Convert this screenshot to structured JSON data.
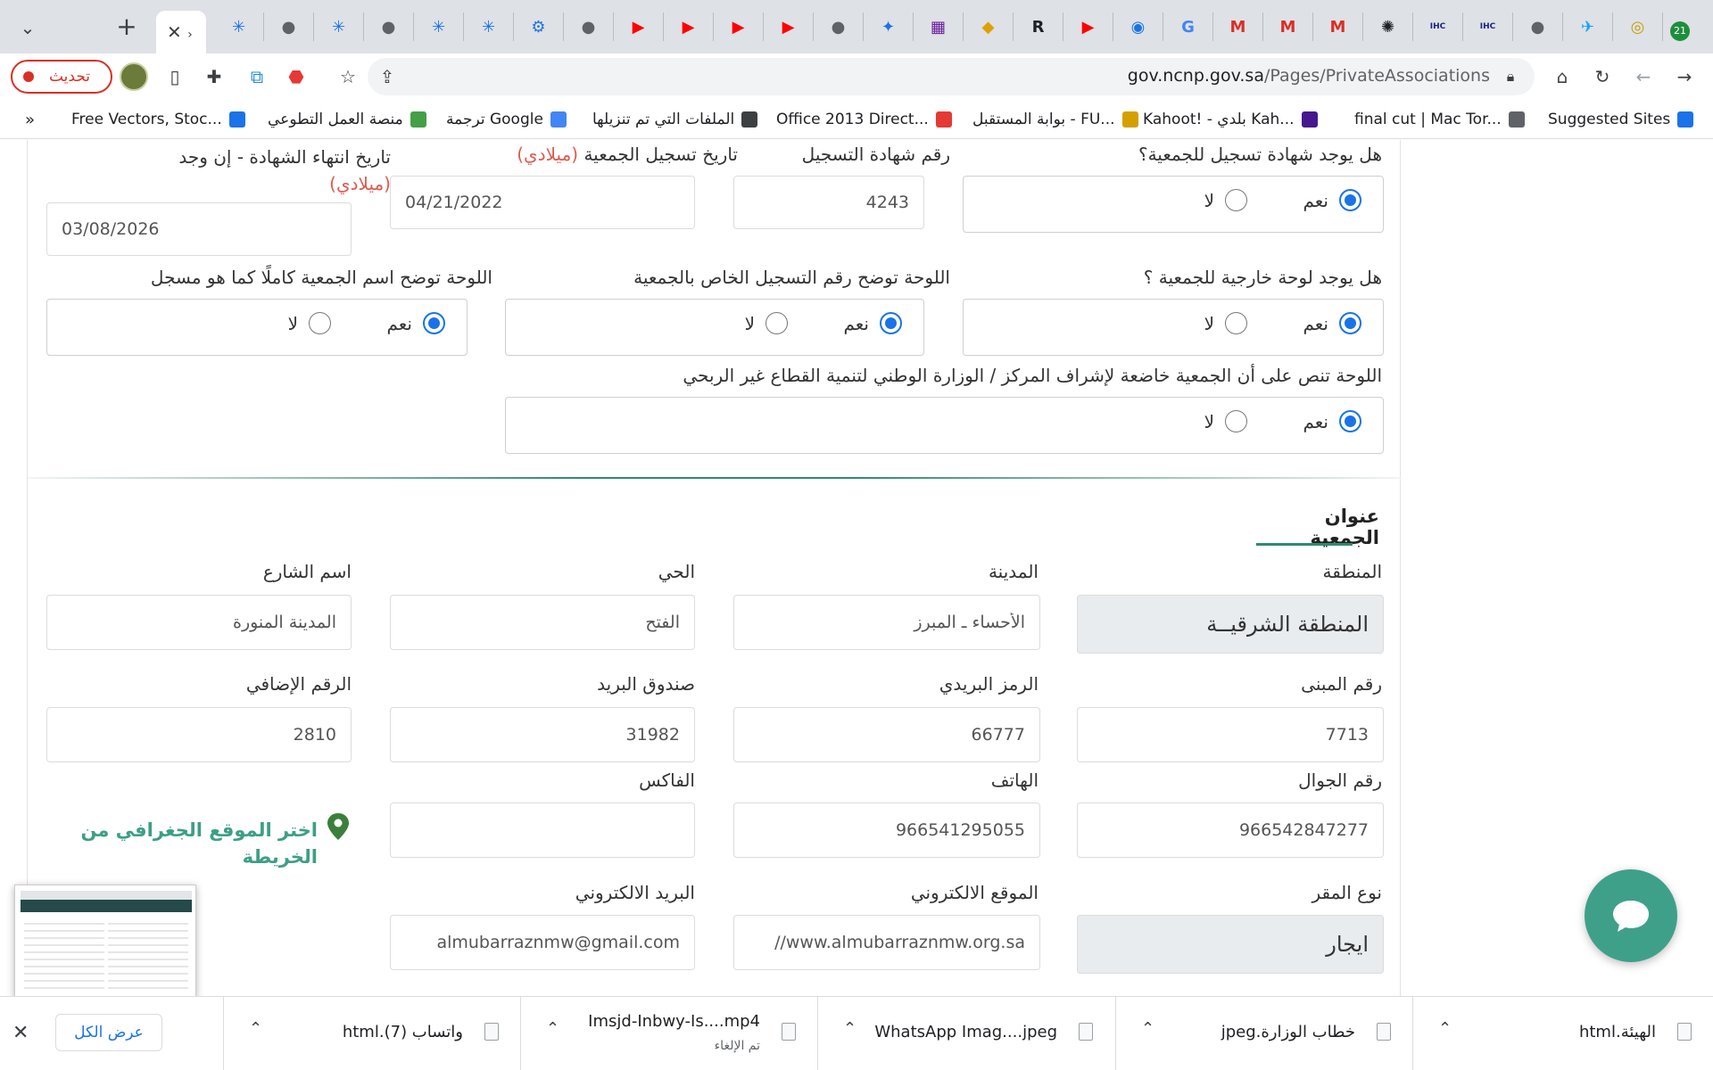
{
  "browser": {
    "url_host": "gov.ncnp.gov.sa",
    "url_path": "/Pages/PrivateAssociations",
    "reload_label": "تحديث",
    "tab_count_badge": "21",
    "tab_icons": [
      {
        "name": "asterisk-icon",
        "color": "#1a73e8",
        "glyph": "✳"
      },
      {
        "name": "globe-icon",
        "color": "#5f6368",
        "glyph": "●"
      },
      {
        "name": "asterisk-icon",
        "color": "#1a73e8",
        "glyph": "✳"
      },
      {
        "name": "globe-icon",
        "color": "#5f6368",
        "glyph": "●"
      },
      {
        "name": "asterisk-icon",
        "color": "#1a73e8",
        "glyph": "✳"
      },
      {
        "name": "asterisk-icon",
        "color": "#1a73e8",
        "glyph": "✳"
      },
      {
        "name": "gear-icon",
        "color": "#1a73e8",
        "glyph": "⚙"
      },
      {
        "name": "globe-icon",
        "color": "#5f6368",
        "glyph": "●"
      },
      {
        "name": "youtube-icon",
        "color": "#ff0000",
        "glyph": "▶"
      },
      {
        "name": "youtube-icon",
        "color": "#ff0000",
        "glyph": "▶"
      },
      {
        "name": "youtube-icon",
        "color": "#ff0000",
        "glyph": "▶"
      },
      {
        "name": "youtube-icon",
        "color": "#ff0000",
        "glyph": "▶"
      },
      {
        "name": "globe-icon",
        "color": "#5f6368",
        "glyph": "●"
      },
      {
        "name": "star-icon",
        "color": "#1a73e8",
        "glyph": "✦"
      },
      {
        "name": "grid-icon",
        "color": "#6a1b9a",
        "glyph": "▦"
      },
      {
        "name": "leaf-icon",
        "color": "#e0a000",
        "glyph": "◆"
      },
      {
        "name": "r-icon",
        "color": "#202124",
        "glyph": "R"
      },
      {
        "name": "youtube-icon",
        "color": "#ff0000",
        "glyph": "▶"
      },
      {
        "name": "robot-icon",
        "color": "#1a73e8",
        "glyph": "◉"
      },
      {
        "name": "translate-icon",
        "color": "#4285f4",
        "glyph": "G"
      },
      {
        "name": "gmail-icon",
        "color": "#d93025",
        "glyph": "M"
      },
      {
        "name": "gmail-icon",
        "color": "#d93025",
        "glyph": "M"
      },
      {
        "name": "gmail-icon",
        "color": "#d93025",
        "glyph": "M"
      },
      {
        "name": "chatgpt-icon",
        "color": "#202124",
        "glyph": "✺"
      },
      {
        "name": "ihc-icon",
        "color": "#1a237e",
        "glyph": "IHC"
      },
      {
        "name": "ihc-icon",
        "color": "#1a237e",
        "glyph": "IHC"
      },
      {
        "name": "globe-icon",
        "color": "#5f6368",
        "glyph": "●"
      },
      {
        "name": "twitter-icon",
        "color": "#1da1f2",
        "glyph": "✈"
      },
      {
        "name": "logo-icon",
        "color": "#c5a000",
        "glyph": "◎"
      }
    ],
    "bookmarks": [
      {
        "label": "Suggested Sites",
        "color": "#1a73e8"
      },
      {
        "label": "final cut | Mac Tor...",
        "color": "#5f6368"
      },
      {
        "label": "Kahoot! - بلدي Kah...",
        "color": "#46178f"
      },
      {
        "label": "بوابة المستقبل - FU...",
        "color": "#d4a000"
      },
      {
        "label": "Office 2013 Direct...",
        "color": "#e53935"
      },
      {
        "label": "الملفات التي تم تنزيلها",
        "color": "#3c4043"
      },
      {
        "label": "ترجمة Google",
        "color": "#4285f4"
      },
      {
        "label": "منصة العمل التطوعي",
        "color": "#43a047"
      },
      {
        "label": "Free Vectors, Stoc...",
        "color": "#1a73e8"
      }
    ]
  },
  "form": {
    "cert_question": "هل يوجد شهادة تسجيل للجمعية؟",
    "cert_number_label": "رقم شهادة التسجيل",
    "cert_number": "4243",
    "reg_date_label": "تاريخ تسجيل الجمعية",
    "reg_date_suffix": "(ميلادي)",
    "reg_date": "04/21/2022",
    "expiry_label": "تاريخ انتهاء الشهادة - إن وجد",
    "expiry_suffix": "(ميلادي)",
    "expiry_date": "03/08/2026",
    "yes": "نعم",
    "no": "لا",
    "sign_question": "هل يوجد لوحة خارجية للجمعية ؟",
    "sign_regnum_question": "اللوحة توضح رقم التسجيل الخاص بالجمعية",
    "sign_name_question": "اللوحة توضح اسم الجمعية كاملًا كما هو مسجل",
    "sign_supervision_question": "اللوحة تنص على أن الجمعية خاضعة لإشراف المركز / الوزارة الوطني لتنمية القطاع غير الربحي"
  },
  "address": {
    "title": "عنوان الجمعية",
    "region_label": "المنطقة",
    "region": "المنطقة الشرقيــة",
    "city_label": "المدينة",
    "city": "الأحساء ـ المبرز",
    "district_label": "الحي",
    "district": "الفتح",
    "street_label": "اسم الشارع",
    "street": "المدينة المنورة",
    "building_label": "رقم المبنى",
    "building": "7713",
    "postal_label": "الرمز البريدي",
    "postal": "66777",
    "pobox_label": "صندوق البريد",
    "pobox": "31982",
    "extra_label": "الرقم الإضافي",
    "extra": "2810",
    "mobile_label": "رقم الجوال",
    "mobile": "966542847277",
    "phone_label": "الهاتف",
    "phone": "966541295055",
    "fax_label": "الفاكس",
    "fax": "",
    "map_link": "اختر الموقع الجغرافي من الخريطة",
    "premises_label": "نوع المقر",
    "premises": "ايجار",
    "website_label": "الموقع الالكتروني",
    "website": "//www.almubarraznmw.org.sa",
    "email_label": "البريد الالكتروني",
    "email": "almubarraznmw@gmail.com"
  },
  "downloads": {
    "show_all": "عرض الكل",
    "items": [
      {
        "name": "الهيئة.html",
        "sub": ""
      },
      {
        "name": "خطاب الوزارة.jpeg",
        "sub": ""
      },
      {
        "name": "WhatsApp Imag....jpeg",
        "sub": ""
      },
      {
        "name": "Imsjd-Inbwy-Is....mp4",
        "sub": "تم الإلغاء"
      },
      {
        "name": "واتساب (7).html",
        "sub": ""
      }
    ]
  },
  "colors": {
    "accent_green": "#3fa08a",
    "radio_blue": "#1a73e8",
    "alert_red": "#d93025"
  }
}
